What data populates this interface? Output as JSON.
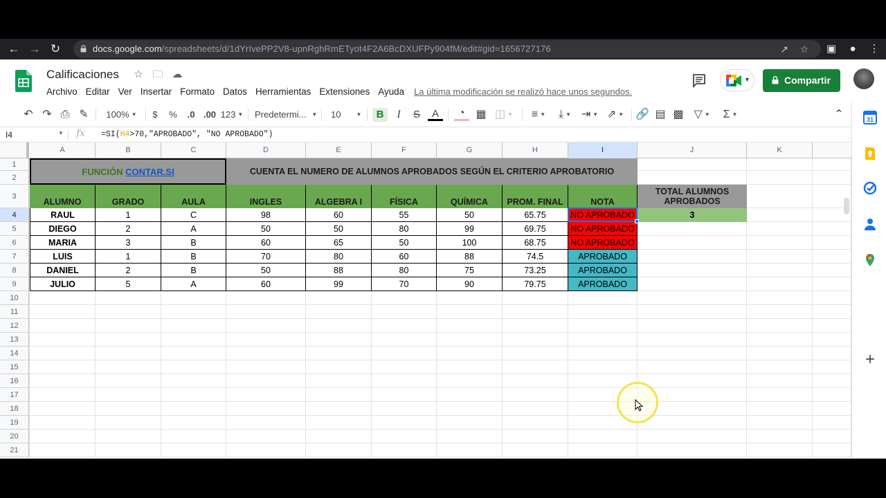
{
  "browser": {
    "url_host": "docs.google.com",
    "url_path": "/spreadsheets/d/1dYrIvePP2V8-upnRghRmETyot4F2A6BcDXUFPy904fM/edit#gid=1656727176"
  },
  "doc": {
    "title": "Calificaciones",
    "menu": [
      "Archivo",
      "Editar",
      "Ver",
      "Insertar",
      "Formato",
      "Datos",
      "Herramientas",
      "Extensiones",
      "Ayuda"
    ],
    "last_edit": "La última modificación se realizó hace unos segundos.",
    "share_label": "Compartir"
  },
  "toolbar": {
    "zoom": "100%",
    "currency": "$",
    "percent": "%",
    "dec_less": ".0",
    "dec_more": ".00",
    "num_format": "123",
    "font": "Predetermi...",
    "font_size": "10"
  },
  "formula_bar": {
    "cell_ref": "I4",
    "fx": "fx",
    "formula_prefix": "=SI(",
    "formula_ref": "H4",
    "formula_suffix": ">70,\"APROBADO\", \"NO APROBADO\")"
  },
  "grid": {
    "columns": [
      "A",
      "B",
      "C",
      "D",
      "E",
      "F",
      "G",
      "H",
      "I",
      "J",
      "K"
    ],
    "selected_column": "I",
    "rows": [
      "1",
      "2",
      "3",
      "4",
      "5",
      "6",
      "7",
      "8",
      "9",
      "10",
      "11",
      "12",
      "13",
      "14",
      "15",
      "16",
      "17",
      "18",
      "19",
      "20",
      "21"
    ],
    "selected_row": "4"
  },
  "sheet": {
    "title_func_prefix": "FUNCIÓN ",
    "title_func_link": "CONTAR.SI",
    "title_main": "CUENTA EL NUMERO DE ALUMNOS APROBADOS SEGÚN EL CRITERIO APROBATORIO",
    "headers": [
      "ALUMNO",
      "GRADO",
      "AULA",
      "INGLES",
      "ALGEBRA I",
      "FÍSICA",
      "QUÍMICA",
      "PROM. FINAL",
      "NOTA"
    ],
    "total_header": "TOTAL ALUMNOS APROBADOS",
    "total_value": "3",
    "records": [
      [
        "RAUL",
        "1",
        "C",
        "98",
        "60",
        "55",
        "50",
        "65.75",
        "NO APROBADO"
      ],
      [
        "DIEGO",
        "2",
        "A",
        "50",
        "50",
        "80",
        "99",
        "69.75",
        "NO APROBADO"
      ],
      [
        "MARIA",
        "3",
        "B",
        "60",
        "65",
        "50",
        "100",
        "68.75",
        "NO APROBADO"
      ],
      [
        "LUIS",
        "1",
        "B",
        "70",
        "80",
        "60",
        "88",
        "74.5",
        "APROBADO"
      ],
      [
        "DANIEL",
        "2",
        "B",
        "50",
        "88",
        "80",
        "75",
        "73.25",
        "APROBADO"
      ],
      [
        "JULIO",
        "5",
        "A",
        "60",
        "99",
        "70",
        "90",
        "79.75",
        "APROBADO"
      ]
    ]
  },
  "colors": {
    "header_green": "#6aa84f",
    "header_gray": "#999999",
    "fail_red": "#ff0000",
    "pass_cyan": "#45b8c6",
    "total_green": "#93c47d",
    "share_green": "#188038"
  }
}
